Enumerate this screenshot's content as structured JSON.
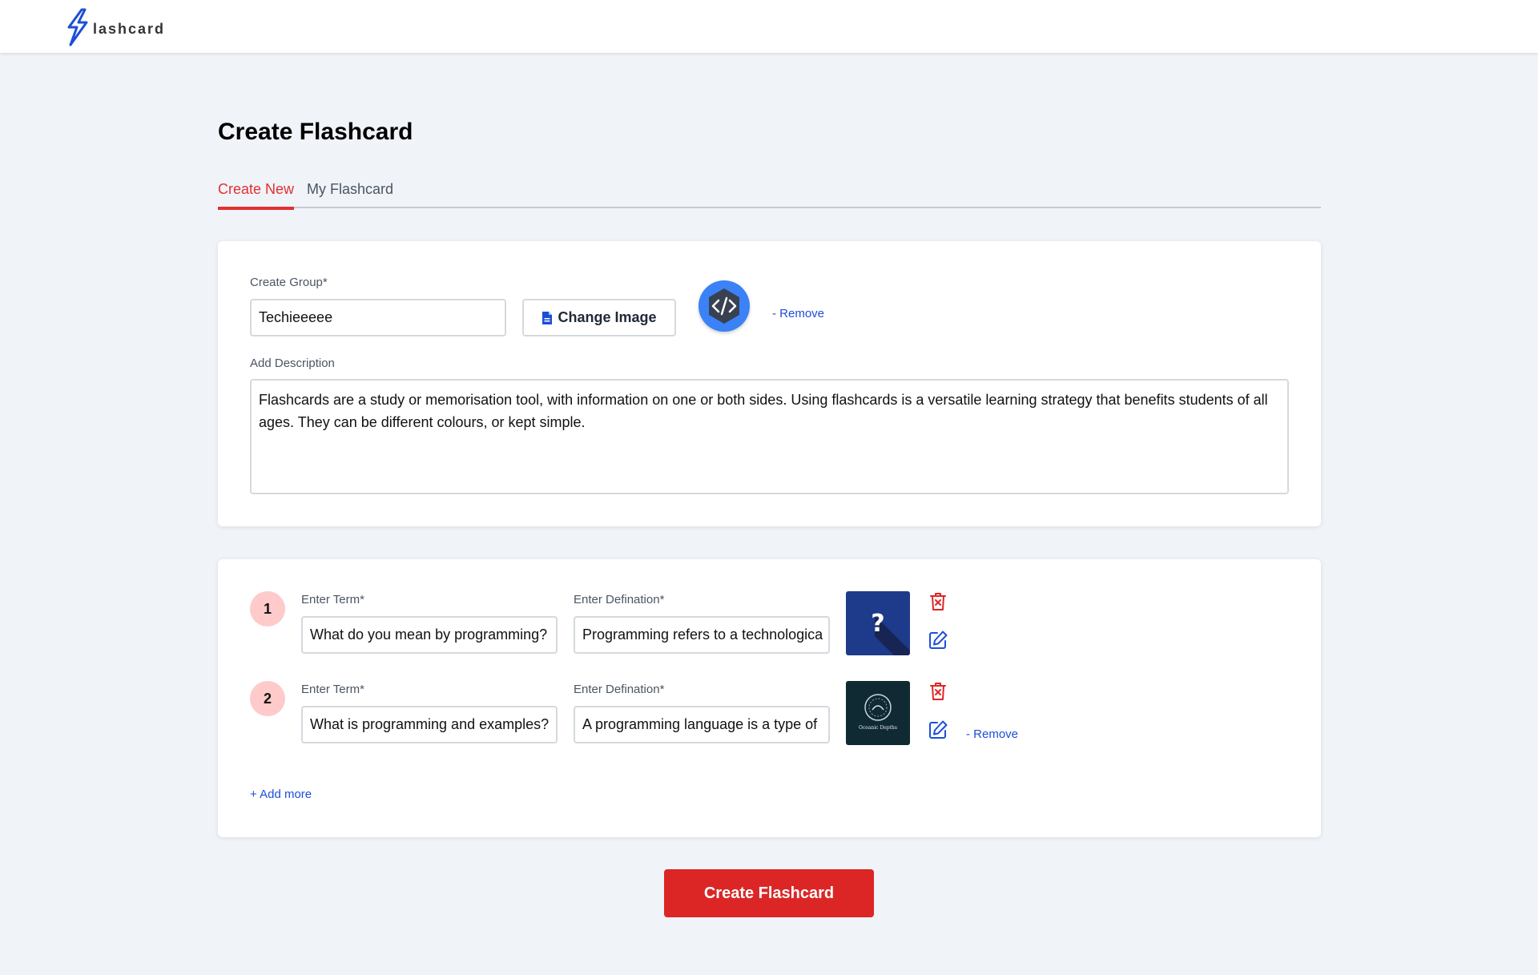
{
  "app": {
    "logo_text": "lashcard"
  },
  "page": {
    "title": "Create Flashcard"
  },
  "tabs": [
    {
      "label": "Create New",
      "active": true
    },
    {
      "label": "My Flashcard",
      "active": false
    }
  ],
  "group": {
    "name_label": "Create Group*",
    "name_value": "Techieeeee",
    "change_image_label": "Change Image",
    "remove_label": "- Remove",
    "description_label": "Add Description",
    "description_value": "Flashcards are a study or memorisation tool, with information on one or both sides. Using flashcards is a versatile learning strategy that benefits students of all ages. They can be different colours, or kept simple.",
    "image_icon": "code-hexagon-icon"
  },
  "terms": [
    {
      "number": "1",
      "term_label": "Enter Term*",
      "term_value": "What do you mean by programming?",
      "definition_label": "Enter Defination*",
      "definition_value": "Programming refers to a technologica",
      "image_icon": "question-mark-icon"
    },
    {
      "number": "2",
      "term_label": "Enter Term*",
      "term_value": "What is programming and examples?",
      "definition_label": "Enter Defination*",
      "definition_value": "A programming language is a type of",
      "image_caption": "Oceanic Depths",
      "remove_label": "- Remove"
    }
  ],
  "add_more_label": "+ Add more",
  "submit_label": "Create Flashcard",
  "colors": {
    "accent": "#dc2626",
    "link": "#1d4ed8",
    "background": "#f0f3f8"
  }
}
